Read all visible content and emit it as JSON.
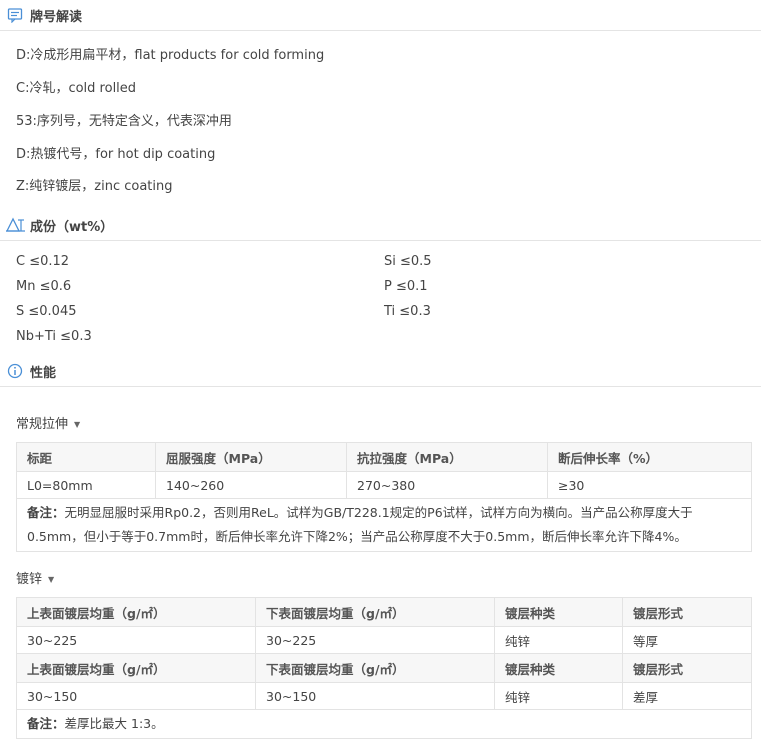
{
  "sections": {
    "grade": {
      "title": "牌号解读"
    },
    "composition": {
      "title": "成份（wt%）"
    },
    "properties": {
      "title": "性能"
    }
  },
  "grade_lines": [
    "D:冷成形用扁平材，flat products for cold forming",
    "C:冷轧，cold rolled",
    "53:序列号，无特定含义，代表深冲用",
    "D:热镀代号，for hot dip coating",
    "Z:纯锌镀层，zinc coating"
  ],
  "composition": {
    "c": "C ≤0.12",
    "si": "Si ≤0.5",
    "mn": "Mn ≤0.6",
    "p": "P ≤0.1",
    "s": "S ≤0.045",
    "ti": "Ti ≤0.3",
    "nbti": "Nb+Ti ≤0.3"
  },
  "tensile": {
    "label": "常规拉伸",
    "headers": [
      "标距",
      "屈服强度（MPa）",
      "抗拉强度（MPa）",
      "断后伸长率（%）"
    ],
    "row": [
      "L0=80mm",
      "140~260",
      "270~380",
      "≥30"
    ],
    "note_label": "备注：",
    "note_text": "无明显屈服时采用Rp0.2，否则用ReL。试样为GB/T228.1规定的P6试样，试样方向为横向。当产品公称厚度大于0.5mm，但小于等于0.7mm时，断后伸长率允许下降2%；当产品公称厚度不大于0.5mm，断后伸长率允许下降4%。"
  },
  "galvanizing": {
    "label": "镀锌",
    "headers": [
      "上表面镀层均重（g/㎡）",
      "下表面镀层均重（g/㎡）",
      "镀层种类",
      "镀层形式"
    ],
    "row1": [
      "30~225",
      "30~225",
      "纯锌",
      "等厚"
    ],
    "row2": [
      "30~150",
      "30~150",
      "纯锌",
      "差厚"
    ],
    "note_label": "备注：",
    "note_text": "差厚比最大 1:3。"
  },
  "colors": {
    "accent": "#4a8fd6",
    "border": "#e3e3e3",
    "header_bg": "#f7f7f7"
  }
}
